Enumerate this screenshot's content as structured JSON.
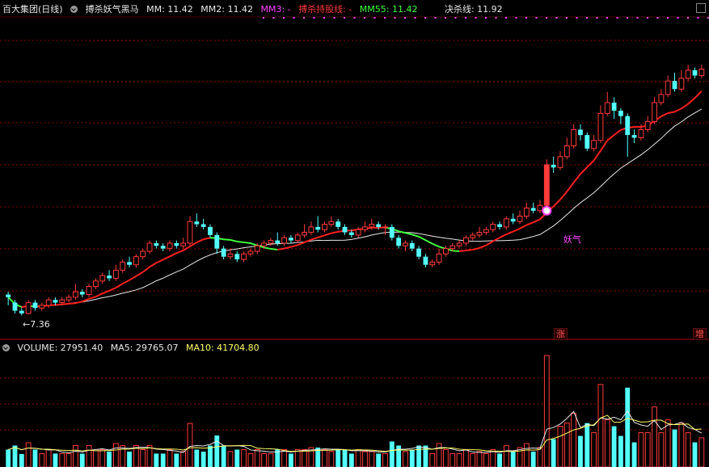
{
  "header": {
    "stock": "百大集团(日线)",
    "indicator": "搏杀妖气黑马",
    "mm": "MM: 11.42",
    "mm2": "MM2: 11.42",
    "mm3": "MM3: -",
    "hold_line": "搏杀持股线: -",
    "mm55": "MM55: 11.42",
    "kill_line": "决杀线: 11.92"
  },
  "volume_header": {
    "volume": "VOLUME: 27951.40",
    "ma5": "MA5: 29765.07",
    "ma10": "MA10: 41704.80"
  },
  "annotations": {
    "low_price": "←7.36",
    "signal": "妖气",
    "tag_rise": "涨",
    "tag_increase": "增"
  },
  "colors": {
    "background": "#000000",
    "up": "#ff3b3b",
    "down": "#54ffff",
    "ma_white": "#e8e8e8",
    "ma_red": "#ff2020",
    "ma_green": "#40ff40",
    "ma_yellow": "#ffff66",
    "magenta": "#ff44ff",
    "grid": "#8b0000"
  },
  "chart_data": {
    "type": "candlestick",
    "series": [
      {
        "name": "K",
        "ohlc": [
          [
            7.75,
            7.7,
            7.8,
            7.55
          ],
          [
            7.6,
            7.45,
            7.65,
            7.4
          ],
          [
            7.45,
            7.4,
            7.5,
            7.36
          ],
          [
            7.4,
            7.6,
            7.65,
            7.38
          ],
          [
            7.6,
            7.5,
            7.65,
            7.45
          ],
          [
            7.5,
            7.55,
            7.6,
            7.45
          ],
          [
            7.55,
            7.65,
            7.7,
            7.5
          ],
          [
            7.65,
            7.6,
            7.7,
            7.55
          ],
          [
            7.6,
            7.65,
            7.7,
            7.55
          ],
          [
            7.65,
            7.7,
            7.75,
            7.6
          ],
          [
            7.7,
            7.8,
            7.95,
            7.65
          ],
          [
            7.8,
            7.75,
            7.85,
            7.7
          ],
          [
            7.75,
            7.9,
            7.95,
            7.7
          ],
          [
            7.9,
            8.0,
            8.05,
            7.85
          ],
          [
            8.0,
            8.1,
            8.15,
            7.95
          ],
          [
            8.1,
            8.05,
            8.2,
            8.0
          ],
          [
            8.05,
            8.2,
            8.3,
            8.0
          ],
          [
            8.2,
            8.35,
            8.4,
            8.15
          ],
          [
            8.35,
            8.3,
            8.45,
            8.25
          ],
          [
            8.3,
            8.45,
            8.5,
            8.25
          ],
          [
            8.45,
            8.55,
            8.6,
            8.4
          ],
          [
            8.55,
            8.7,
            8.75,
            8.5
          ],
          [
            8.7,
            8.65,
            8.75,
            8.6
          ],
          [
            8.65,
            8.6,
            8.7,
            8.55
          ],
          [
            8.6,
            8.7,
            8.75,
            8.55
          ],
          [
            8.7,
            8.65,
            8.75,
            8.6
          ],
          [
            8.65,
            8.7,
            8.8,
            8.6
          ],
          [
            8.7,
            9.1,
            9.2,
            8.65
          ],
          [
            9.1,
            9.05,
            9.25,
            9.0
          ],
          [
            9.05,
            9.0,
            9.15,
            8.95
          ],
          [
            9.0,
            8.85,
            9.05,
            8.8
          ],
          [
            8.85,
            8.6,
            8.9,
            8.5
          ],
          [
            8.6,
            8.45,
            8.65,
            8.4
          ],
          [
            8.45,
            8.5,
            8.6,
            8.4
          ],
          [
            8.5,
            8.4,
            8.55,
            8.35
          ],
          [
            8.4,
            8.5,
            8.55,
            8.35
          ],
          [
            8.5,
            8.55,
            8.6,
            8.45
          ],
          [
            8.55,
            8.65,
            8.7,
            8.5
          ],
          [
            8.65,
            8.7,
            8.75,
            8.6
          ],
          [
            8.7,
            8.75,
            8.8,
            8.65
          ],
          [
            8.75,
            8.7,
            8.9,
            8.65
          ],
          [
            8.7,
            8.8,
            8.85,
            8.65
          ],
          [
            8.8,
            8.75,
            8.85,
            8.7
          ],
          [
            8.75,
            8.85,
            8.9,
            8.7
          ],
          [
            8.85,
            8.9,
            9.05,
            8.8
          ],
          [
            8.9,
            9.0,
            9.1,
            8.85
          ],
          [
            9.0,
            8.95,
            9.2,
            8.9
          ],
          [
            8.95,
            9.05,
            9.1,
            8.9
          ],
          [
            9.05,
            9.1,
            9.2,
            9.0
          ],
          [
            9.1,
            9.0,
            9.15,
            8.95
          ],
          [
            9.0,
            8.9,
            9.05,
            8.85
          ],
          [
            8.9,
            8.85,
            8.95,
            8.8
          ],
          [
            8.85,
            8.95,
            9.0,
            8.8
          ],
          [
            8.95,
            9.0,
            9.1,
            8.9
          ],
          [
            9.0,
            9.05,
            9.15,
            8.95
          ],
          [
            9.05,
            9.0,
            9.1,
            8.95
          ],
          [
            9.0,
            9.0,
            9.05,
            8.85
          ],
          [
            9.0,
            8.8,
            9.05,
            8.75
          ],
          [
            8.8,
            8.65,
            8.85,
            8.6
          ],
          [
            8.65,
            8.7,
            8.75,
            8.55
          ],
          [
            8.7,
            8.6,
            8.75,
            8.55
          ],
          [
            8.6,
            8.45,
            8.65,
            8.4
          ],
          [
            8.45,
            8.3,
            8.5,
            8.25
          ],
          [
            8.3,
            8.35,
            8.4,
            8.25
          ],
          [
            8.35,
            8.5,
            8.6,
            8.3
          ],
          [
            8.5,
            8.6,
            8.65,
            8.45
          ],
          [
            8.6,
            8.65,
            8.7,
            8.55
          ],
          [
            8.65,
            8.7,
            8.75,
            8.6
          ],
          [
            8.7,
            8.8,
            8.85,
            8.65
          ],
          [
            8.8,
            8.85,
            8.9,
            8.75
          ],
          [
            8.85,
            8.9,
            9.0,
            8.8
          ],
          [
            8.9,
            8.95,
            9.0,
            8.85
          ],
          [
            8.95,
            9.05,
            9.1,
            8.9
          ],
          [
            9.05,
            9.0,
            9.1,
            8.95
          ],
          [
            9.0,
            9.15,
            9.2,
            8.95
          ],
          [
            9.15,
            9.1,
            9.25,
            9.05
          ],
          [
            9.1,
            9.2,
            9.3,
            9.05
          ],
          [
            9.2,
            9.35,
            9.45,
            9.15
          ],
          [
            9.35,
            9.3,
            9.45,
            9.25
          ],
          [
            9.3,
            9.4,
            9.5,
            9.25
          ],
          [
            9.4,
            10.15,
            10.25,
            9.35
          ],
          [
            10.15,
            10.1,
            10.3,
            10.0
          ],
          [
            10.1,
            10.3,
            10.4,
            10.05
          ],
          [
            10.3,
            10.5,
            10.65,
            10.25
          ],
          [
            10.5,
            10.8,
            10.9,
            10.45
          ],
          [
            10.8,
            10.7,
            10.9,
            10.6
          ],
          [
            10.7,
            10.45,
            10.75,
            10.4
          ],
          [
            10.45,
            10.6,
            10.7,
            10.4
          ],
          [
            10.6,
            11.1,
            11.25,
            10.55
          ],
          [
            11.1,
            11.3,
            11.5,
            11.05
          ],
          [
            11.3,
            11.15,
            11.4,
            11.0
          ],
          [
            11.15,
            11.05,
            11.2,
            10.9
          ],
          [
            11.05,
            10.7,
            11.1,
            10.3
          ],
          [
            10.7,
            10.65,
            10.8,
            10.55
          ],
          [
            10.65,
            10.8,
            10.9,
            10.6
          ],
          [
            10.8,
            10.95,
            11.05,
            10.75
          ],
          [
            10.95,
            11.3,
            11.4,
            10.9
          ],
          [
            11.3,
            11.45,
            11.55,
            11.25
          ],
          [
            11.45,
            11.7,
            11.8,
            11.4
          ],
          [
            11.7,
            11.55,
            11.85,
            11.5
          ],
          [
            11.55,
            11.75,
            11.9,
            11.5
          ],
          [
            11.75,
            11.9,
            12.0,
            11.7
          ],
          [
            11.9,
            11.8,
            11.95,
            11.75
          ],
          [
            11.8,
            11.92,
            12.0,
            11.75
          ]
        ]
      }
    ],
    "volume": {
      "ma5": 29765.07,
      "ma10": 41704.8,
      "last": 27951.4
    }
  }
}
